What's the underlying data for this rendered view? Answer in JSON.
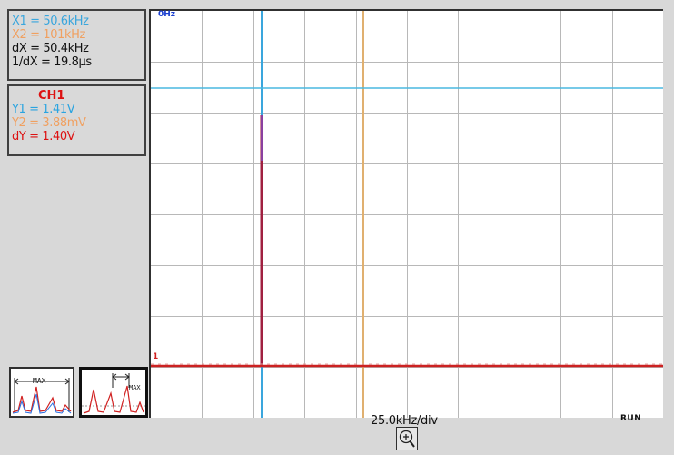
{
  "colors": {
    "x1": "#3aa6dd",
    "x2": "#f0a060",
    "dx": "#111111",
    "y1": "#2aa4e0",
    "y2": "#f0a060",
    "dy": "#dd1111",
    "channel": "#dd1111",
    "grid": "#b8b8b8",
    "cursor_x1": "#3aa6dd",
    "cursor_x2": "#e0b070",
    "cursor_y1": "#4ab8e0",
    "trace": "#cc2222",
    "peak": "#a02040"
  },
  "cursors": {
    "x1": "X1 = 50.6kHz",
    "x2": "X2 = 101kHz",
    "dx": "dX = 50.4kHz",
    "inv_dx": "1/dX = 19.8µs"
  },
  "channel": {
    "name": "CH1",
    "y1": "Y1 = 1.41V",
    "y2": "Y2 = 3.88mV",
    "dy": "dY = 1.40V"
  },
  "plot": {
    "origin_label": "0Hz",
    "scale_label": "25.0kHz/div",
    "status": "RUN",
    "channel_marker": "1"
  },
  "icons": {
    "mode1": "peak-max-icon",
    "mode2": "peak-width-max-icon",
    "zoom": "zoom-in-icon"
  },
  "mode_labels": [
    "MAX",
    "MAX"
  ]
}
